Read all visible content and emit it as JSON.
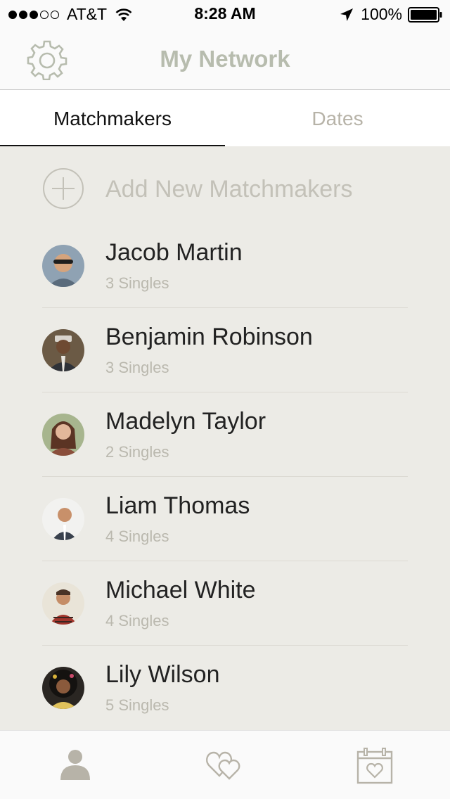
{
  "status_bar": {
    "carrier": "AT&T",
    "time": "8:28 AM",
    "battery": "100%",
    "signal_bars_filled": 3,
    "signal_bars_total": 5
  },
  "nav": {
    "title": "My Network",
    "settings_icon": "gear-icon"
  },
  "tabs": [
    {
      "label": "Matchmakers",
      "active": true
    },
    {
      "label": "Dates",
      "active": false
    }
  ],
  "add": {
    "label": "Add New Matchmakers",
    "icon": "plus-circle-icon"
  },
  "matchmakers": [
    {
      "name": "Jacob Martin",
      "singles": "3 Singles"
    },
    {
      "name": "Benjamin Robinson",
      "singles": "3 Singles"
    },
    {
      "name": "Madelyn Taylor",
      "singles": "2 Singles"
    },
    {
      "name": "Liam Thomas",
      "singles": "4 Singles"
    },
    {
      "name": "Michael White",
      "singles": "4 Singles"
    },
    {
      "name": "Lily Wilson",
      "singles": "5 Singles"
    }
  ],
  "tab_bar": [
    {
      "icon": "person-icon",
      "active": true
    },
    {
      "icon": "hearts-icon",
      "active": false
    },
    {
      "icon": "calendar-heart-icon",
      "active": false
    }
  ],
  "colors": {
    "accent": "#b7bcae",
    "list_background": "#ecebe6",
    "primary_text": "#222222",
    "secondary_text": "#bab8ae"
  }
}
